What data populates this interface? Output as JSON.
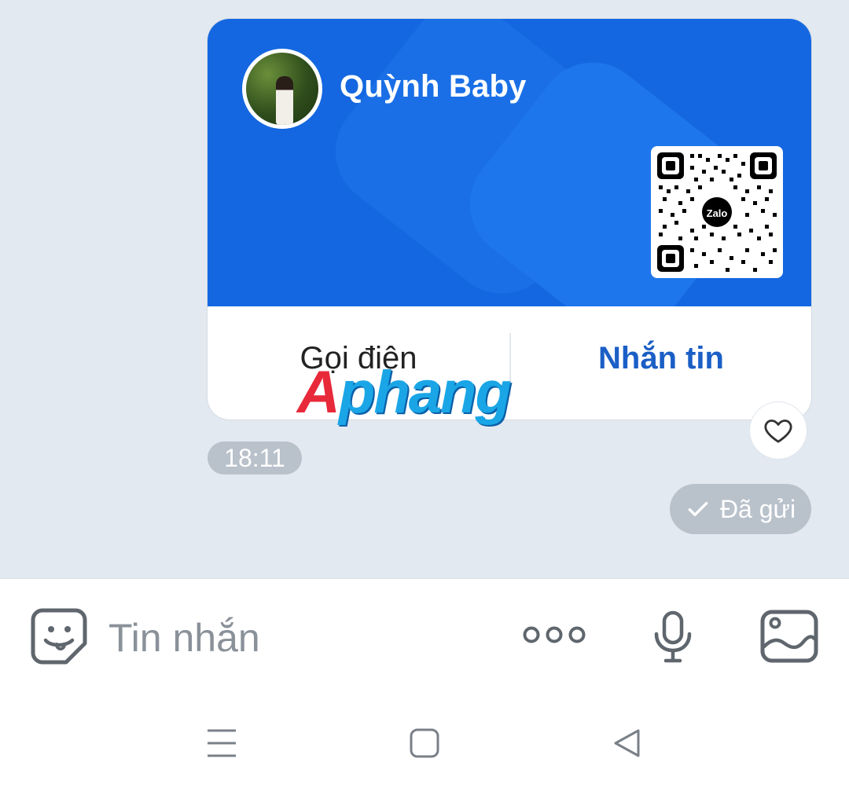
{
  "card": {
    "contact_name": "Quỳnh Baby",
    "qr_logo_text": "Zalo",
    "call_label": "Gọi điện",
    "message_label": "Nhắn tin"
  },
  "watermark": {
    "first_letter": "A",
    "rest": "phang"
  },
  "message_meta": {
    "time": "18:11",
    "status": "Đã gửi"
  },
  "composer": {
    "placeholder": "Tin nhắn"
  },
  "icons": {
    "emoji": "sticker-smile-icon",
    "more": "more-dots-icon",
    "mic": "microphone-icon",
    "image": "image-gallery-icon",
    "heart": "heart-outline-icon",
    "check": "check-icon",
    "nav_menu": "menu-icon",
    "nav_home": "home-square-icon",
    "nav_back": "back-triangle-icon"
  },
  "colors": {
    "card_blue": "#1467e0",
    "message_action": "#1b5fc6",
    "chat_background": "#e3e9f0",
    "badge_gray": "#b9c1cb"
  }
}
